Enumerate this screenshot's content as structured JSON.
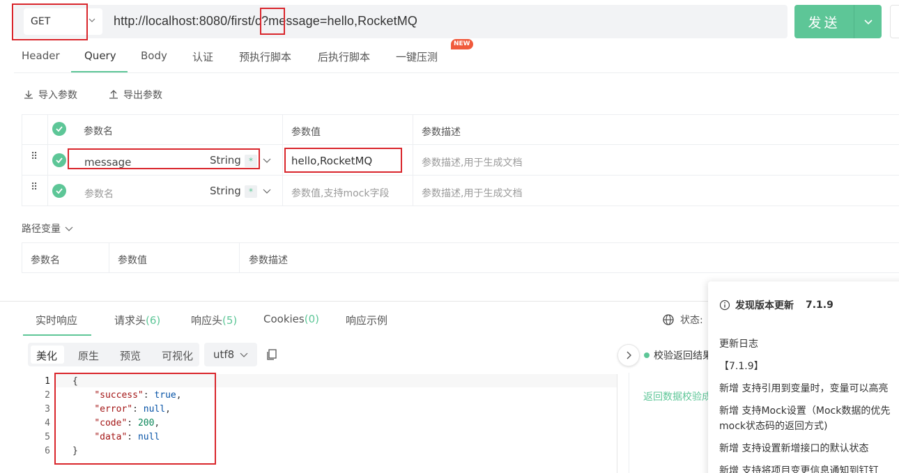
{
  "request": {
    "method": "GET",
    "url": "http://localhost:8080/first/c?message=hello,RocketMQ",
    "send_label": "发送"
  },
  "tabs": [
    {
      "label": "Header"
    },
    {
      "label": "Query"
    },
    {
      "label": "Body"
    },
    {
      "label": "认证"
    },
    {
      "label": "预执行脚本"
    },
    {
      "label": "后执行脚本"
    },
    {
      "label": "一键压测"
    }
  ],
  "new_badge": "NEW",
  "toolbar": {
    "import_label": "导入参数",
    "export_label": "导出参数"
  },
  "params_table": {
    "headers": [
      "参数名",
      "参数值",
      "参数描述"
    ],
    "rows": [
      {
        "name": "message",
        "type": "String",
        "required": "*",
        "value": "hello,RocketMQ",
        "desc_placeholder": "参数描述,用于生成文档"
      },
      {
        "name_placeholder": "参数名",
        "type": "String",
        "required": "*",
        "value_placeholder": "参数值,支持mock字段",
        "desc_placeholder": "参数描述,用于生成文档"
      }
    ]
  },
  "path_vars": {
    "label": "路径变量",
    "headers": [
      "参数名",
      "参数值",
      "参数描述"
    ]
  },
  "response": {
    "tabs": [
      {
        "label": "实时响应",
        "count": ""
      },
      {
        "label": "请求头",
        "count": "(6)"
      },
      {
        "label": "响应头",
        "count": "(5)"
      },
      {
        "label": "Cookies",
        "count": "(0)"
      },
      {
        "label": "响应示例",
        "count": ""
      }
    ],
    "status_label": "状态:",
    "formats": [
      "美化",
      "原生",
      "预览",
      "可视化"
    ],
    "encoding": "utf8",
    "body_lines": [
      "1",
      "2",
      "3",
      "4",
      "5",
      "6"
    ],
    "json": {
      "success": "true",
      "error": "null",
      "code": "200",
      "data": "null"
    },
    "verify_label": "校验返回结果",
    "verify_link": "返回数据校验成功"
  },
  "update_popup": {
    "title": "发现版本更新",
    "version": "7.1.9",
    "changelog_label": "更新日志",
    "version_tag": "【7.1.9】",
    "items": [
      "新增 支持引用到变量时，变量可以高亮",
      "新增 支持Mock设置（Mock数据的优先",
      "mock状态码的返回方式)",
      "新增 支持设置新增接口的默认状态",
      "新增 支持将项目变更信息通知到钉钉"
    ]
  },
  "colors": {
    "accent": "#5dc697",
    "highlight_border": "#d9252b",
    "badge": "#f05a3c"
  }
}
